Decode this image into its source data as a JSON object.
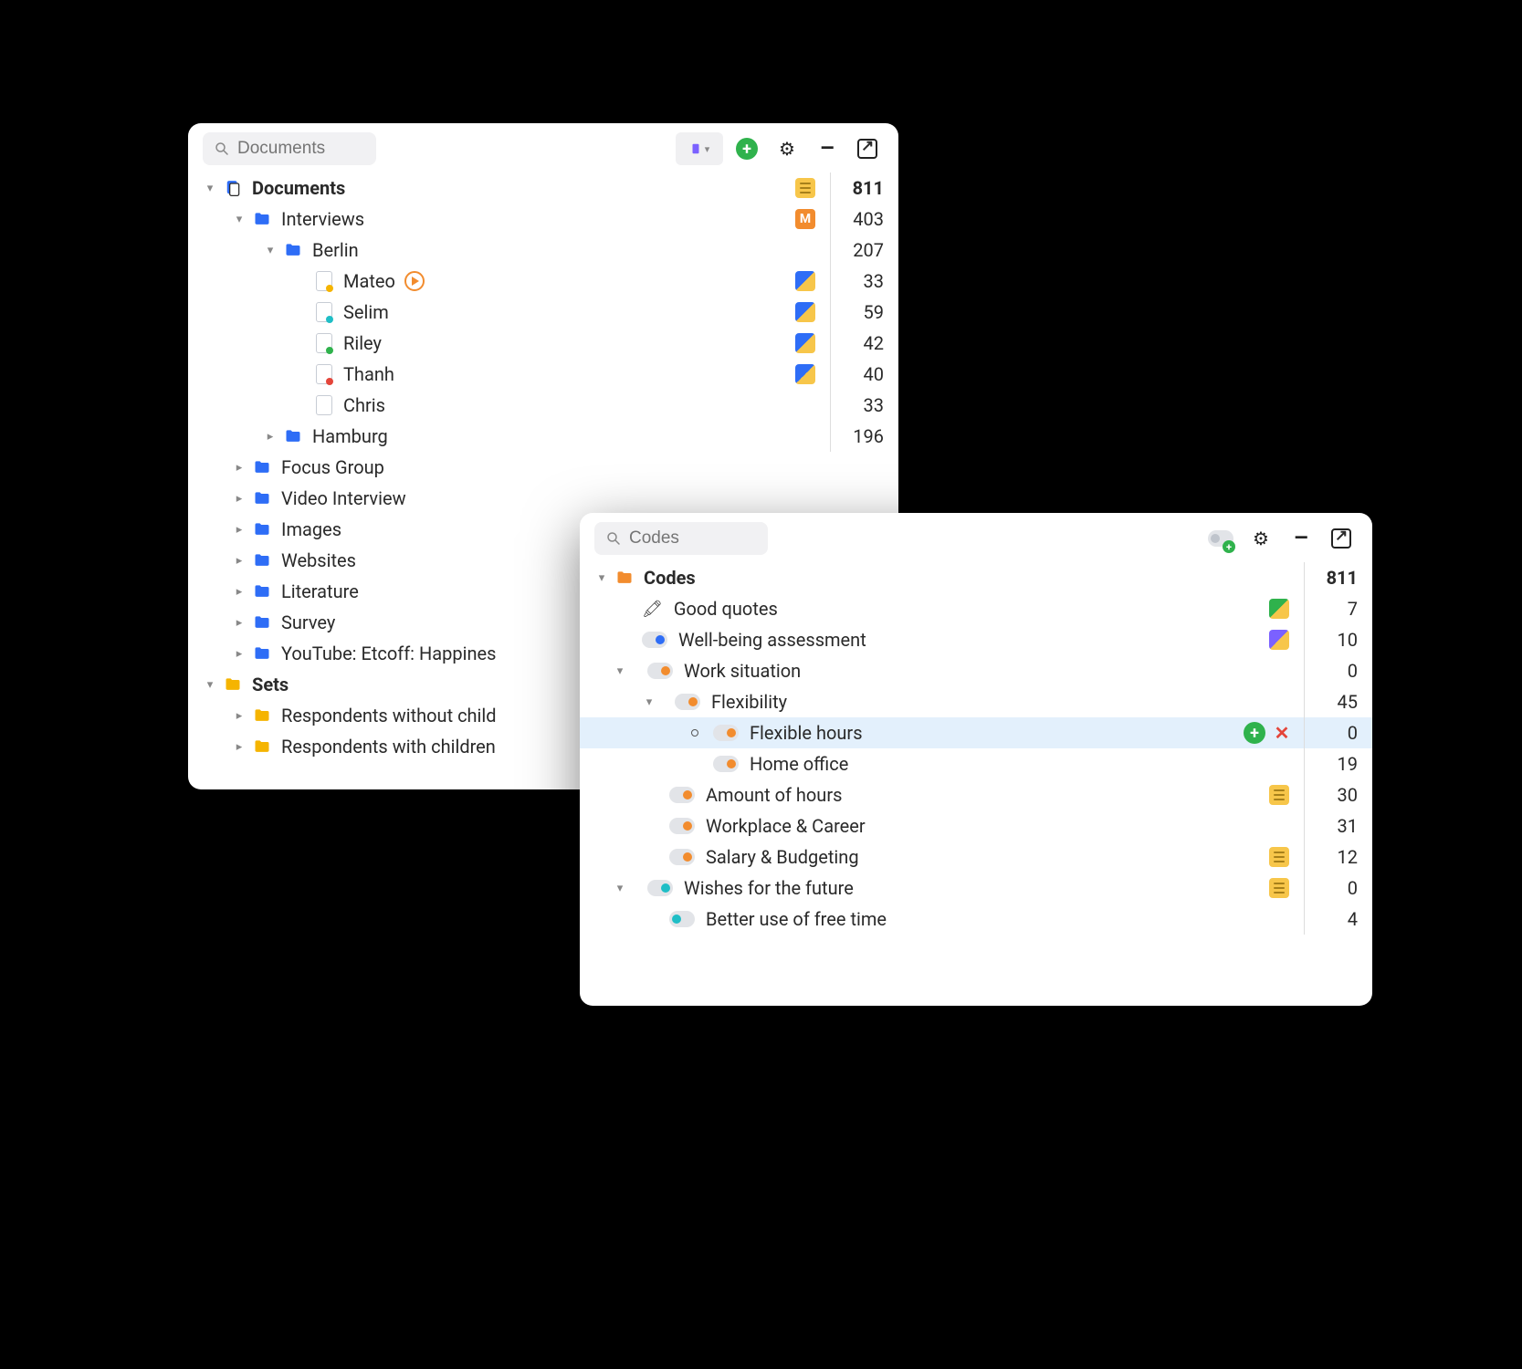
{
  "docs_panel": {
    "search_placeholder": "Documents",
    "root_label": "Documents",
    "root_count": 811,
    "tree": {
      "interviews": {
        "label": "Interviews",
        "count": 403
      },
      "berlin": {
        "label": "Berlin",
        "count": 207
      },
      "mateo": {
        "label": "Mateo",
        "count": 33
      },
      "selim": {
        "label": "Selim",
        "count": 59
      },
      "riley": {
        "label": "Riley",
        "count": 42
      },
      "thanh": {
        "label": "Thanh",
        "count": 40
      },
      "chris": {
        "label": "Chris",
        "count": 33
      },
      "hamburg": {
        "label": "Hamburg",
        "count": 196
      },
      "focus_group": {
        "label": "Focus Group"
      },
      "video_interview": {
        "label": "Video Interview"
      },
      "images": {
        "label": "Images"
      },
      "websites": {
        "label": "Websites"
      },
      "literature": {
        "label": "Literature"
      },
      "survey": {
        "label": "Survey"
      },
      "youtube": {
        "label": "YouTube: Etcoff: Happines"
      }
    },
    "sets_label": "Sets",
    "sets": {
      "without": "Respondents without child",
      "with": "Respondents with children"
    }
  },
  "codes_panel": {
    "search_placeholder": "Codes",
    "root_label": "Codes",
    "root_count": 811,
    "items": {
      "good_quotes": {
        "label": "Good quotes",
        "count": 7
      },
      "wellbeing": {
        "label": "Well-being assessment",
        "count": 10
      },
      "work_situation": {
        "label": "Work situation",
        "count": 0
      },
      "flexibility": {
        "label": "Flexibility",
        "count": 45
      },
      "flexible_hours": {
        "label": "Flexible hours",
        "count": 0
      },
      "home_office": {
        "label": "Home office",
        "count": 19
      },
      "amount_hours": {
        "label": "Amount of hours",
        "count": 30
      },
      "workplace_career": {
        "label": "Workplace & Career",
        "count": 31
      },
      "salary": {
        "label": "Salary & Budgeting",
        "count": 12
      },
      "wishes": {
        "label": "Wishes for the future",
        "count": 0
      },
      "freetime": {
        "label": "Better use of free time",
        "count": 4
      }
    }
  }
}
